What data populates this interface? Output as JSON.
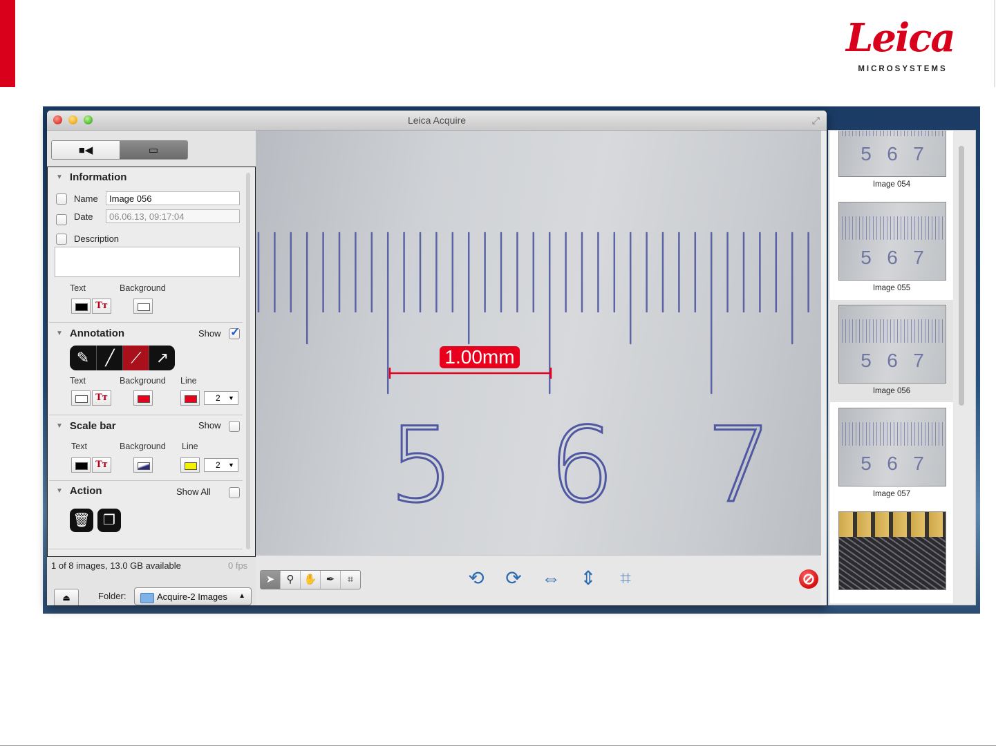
{
  "slide": {
    "logo_script": "Leica",
    "logo_sub": "MICROSYSTEMS",
    "brand_red": "#d9001b"
  },
  "window": {
    "title": "Leica Acquire",
    "controls": [
      "close",
      "minimize",
      "zoom"
    ],
    "fullscreen_icon": "fullscreen-arrows-icon"
  },
  "mode_switch": {
    "options": [
      "video-camera-icon",
      "still-image-icon"
    ],
    "selected": "still-image-icon"
  },
  "information": {
    "title": "Information",
    "name_label": "Name",
    "name_value": "Image 056",
    "date_label": "Date",
    "date_value": "06.06.13, 09:17:04",
    "description_label": "Description",
    "description_value": "",
    "text_label": "Text",
    "background_label": "Background"
  },
  "annotation": {
    "title": "Annotation",
    "show_label": "Show",
    "show_checked": true,
    "tools": [
      "pen-icon",
      "line-icon",
      "measure-icon",
      "arrow-icon"
    ],
    "active_tool": "measure-icon",
    "text_label": "Text",
    "background_label": "Background",
    "line_label": "Line",
    "line_width": "2",
    "background_color": "#e8001d",
    "line_color": "#e8001d"
  },
  "scale_bar": {
    "title": "Scale bar",
    "show_label": "Show",
    "show_checked": false,
    "text_label": "Text",
    "background_label": "Background",
    "line_label": "Line",
    "line_width": "2",
    "line_color": "#f5f000"
  },
  "action": {
    "title": "Action",
    "show_all_label": "Show All",
    "show_all_checked": false,
    "buttons": [
      "trash-icon",
      "copy-icon"
    ]
  },
  "status": {
    "images_text": "1 of 8 images, 13.0 GB available",
    "fps_text": "0 fps",
    "folder_label": "Folder:",
    "folder_value": "Acquire-2 Images"
  },
  "image": {
    "measurement_label": "1.00mm",
    "ruler_numbers": [
      "5",
      "6",
      "7"
    ]
  },
  "view_tools": {
    "pointer": "arrow-pointer-icon",
    "zoom": "magnifier-icon",
    "pan": "hand-icon",
    "picker": "eyedropper-icon",
    "crop": "crop-icon",
    "actions": [
      "rotate-left-icon",
      "rotate-right-icon",
      "flip-horizontal-icon",
      "flip-vertical-icon",
      "crop-image-icon"
    ],
    "stop": "stop-icon"
  },
  "thumbnails": [
    {
      "caption": "Image 054",
      "kind": "ruler"
    },
    {
      "caption": "Image 055",
      "kind": "ruler"
    },
    {
      "caption": "Image 056",
      "kind": "ruler",
      "selected": true
    },
    {
      "caption": "Image 057",
      "kind": "ruler"
    },
    {
      "caption": "",
      "kind": "circuit"
    }
  ]
}
